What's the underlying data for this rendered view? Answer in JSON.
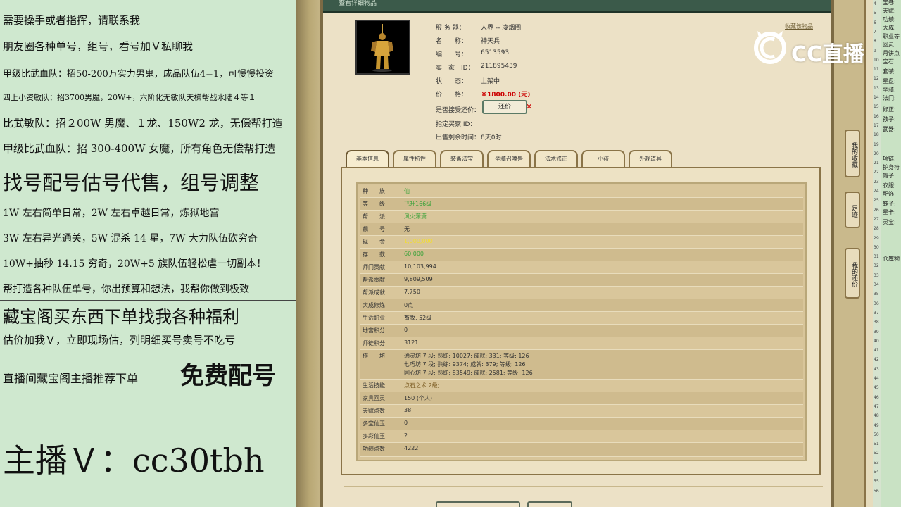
{
  "promo": {
    "lines": [
      "需要操手或者指挥，请联系我",
      "朋友圈各种单号，组号，看号加Ｖ私聊我",
      "甲级比武血队：招50-200万实力男鬼，成品队伍4=1，可慢慢投资",
      "四上小资敏队：招3700男魔，20W+，六阶化无敏队天梯帮战水陆４等１",
      "比武敏队：招２00W 男魔、１龙、150W2 龙，无偿帮打造",
      "甲级比武血队：招 300-400W 女魔，所有角色无偿帮打造",
      "找号配号估号代售，组号调整",
      "1W 左右简单日常，2W 左右卓越日常，炼狱地宫",
      "3W 左右异光通关，5W 混杀 14 星，7W 大力队伍砍穷奇",
      "10W+抽秒 14.15 穷奇，20W+5 族队伍轻松虐一切副本！",
      "帮打造各种队伍单号，你出预算和想法，我帮你做到极致",
      "藏宝阁买东西下单找我各种福利",
      "估价加我Ｖ，立即现场估，列明细买号卖号不吃亏",
      "直播间藏宝阁主播推荐下单",
      "免费配号",
      "主播Ｖ：cc30tbh"
    ]
  },
  "dialog": {
    "title": "查看详细物品",
    "fav_link": "收藏该物品",
    "fields": [
      {
        "key": "服 务 器：",
        "value": "人界 -- 凌烟阁"
      },
      {
        "key": "名　　称：",
        "value": "神天兵"
      },
      {
        "key": "编　　号：",
        "value": "6513593"
      },
      {
        "key": "卖　家　ID：",
        "value": "211895439"
      },
      {
        "key": "状　　态：",
        "value": "上架中"
      },
      {
        "key": "价　　格：",
        "value": "￥1800.00 (元)"
      },
      {
        "key": "是否接受还价：",
        "value": ""
      },
      {
        "key": "指定买家 ID：",
        "value": ""
      },
      {
        "key": "出售剩余时间：",
        "value": "8天0时"
      }
    ],
    "counter_offer_label": "还价",
    "tabs": [
      "基本信息",
      "属性抗性",
      "装备法宝",
      "坐骑召唤兽",
      "法术修正",
      "小孩",
      "外观道具"
    ],
    "rows": [
      {
        "k": "种　　族",
        "v": "仙"
      },
      {
        "k": "等　　级",
        "v": "飞升166级"
      },
      {
        "k": "帮　　派",
        "v": "风火潇潇"
      },
      {
        "k": "靓　　号",
        "v": "无"
      },
      {
        "k": "现　　金",
        "v": "1,000,000"
      },
      {
        "k": "存　　款",
        "v": "60,000"
      },
      {
        "k": "师门贡献",
        "v": "10,103,994"
      },
      {
        "k": "帮派贡献",
        "v": "9,809,509"
      },
      {
        "k": "帮派成就",
        "v": "7,750"
      },
      {
        "k": "大成修炼",
        "v": "0点"
      },
      {
        "k": "生活职业",
        "v": "畜牧, 52级"
      },
      {
        "k": "地宫积分",
        "v": "0"
      },
      {
        "k": "师徒积分",
        "v": "3121"
      },
      {
        "k": "作　　坊",
        "v": "通灵坊 7 段; 熟练: 10027; 成就: 331; 等级: 126"
      },
      {
        "k": "",
        "v": "七巧坊 7 段; 熟练: 9374; 成就: 379; 等级: 126"
      },
      {
        "k": "",
        "v": "同心坊 7 段; 熟练: 83549; 成就: 2581; 等级: 126"
      },
      {
        "k": "生活技能",
        "v": "点石之术 2级;"
      },
      {
        "k": "家具回灵",
        "v": "150 (个人)"
      },
      {
        "k": "天赋点数",
        "v": "38"
      },
      {
        "k": "多宝仙玉",
        "v": "0"
      },
      {
        "k": "多彩仙玉",
        "v": "2"
      },
      {
        "k": "功绩点数",
        "v": "4222"
      }
    ]
  },
  "side_buttons": [
    "我的收藏",
    "足迹",
    "我的还价"
  ],
  "right_panel": {
    "labels": [
      "宝卷:",
      "天赋:",
      "功绩:",
      "大成:",
      "职业等",
      "回灵:",
      "月饼点",
      "宝石:",
      "套装:",
      "星盘:",
      "坐骑:",
      "法门:",
      "修正:",
      "孩子:",
      "武器:",
      "项链:",
      "护身符",
      "帽子:",
      "衣服:",
      "配饰",
      "鞋子:",
      "星卡:",
      "灵宝:",
      "仓库物"
    ],
    "numbers": [
      "4",
      "5",
      "6",
      "7",
      "8",
      "9",
      "10",
      "11",
      "12",
      "13",
      "14",
      "15",
      "16",
      "17",
      "18",
      "19",
      "20",
      "21",
      "22",
      "23",
      "24",
      "25",
      "26",
      "27",
      "28",
      "29",
      "30",
      "31",
      "32",
      "33",
      "34",
      "35",
      "36",
      "37",
      "38",
      "39",
      "40",
      "41",
      "42",
      "43",
      "44",
      "45",
      "46",
      "47",
      "48",
      "49",
      "50",
      "51",
      "52",
      "53",
      "54",
      "55",
      "56"
    ]
  },
  "logo": {
    "text": "CC直播"
  },
  "colors": {
    "promo_bg": "#cfe8cf",
    "dialog_bg": "#ece1c6",
    "title_bar": "#3b5a4a",
    "price": "#cc0000",
    "green_value": "#3aa23a"
  }
}
